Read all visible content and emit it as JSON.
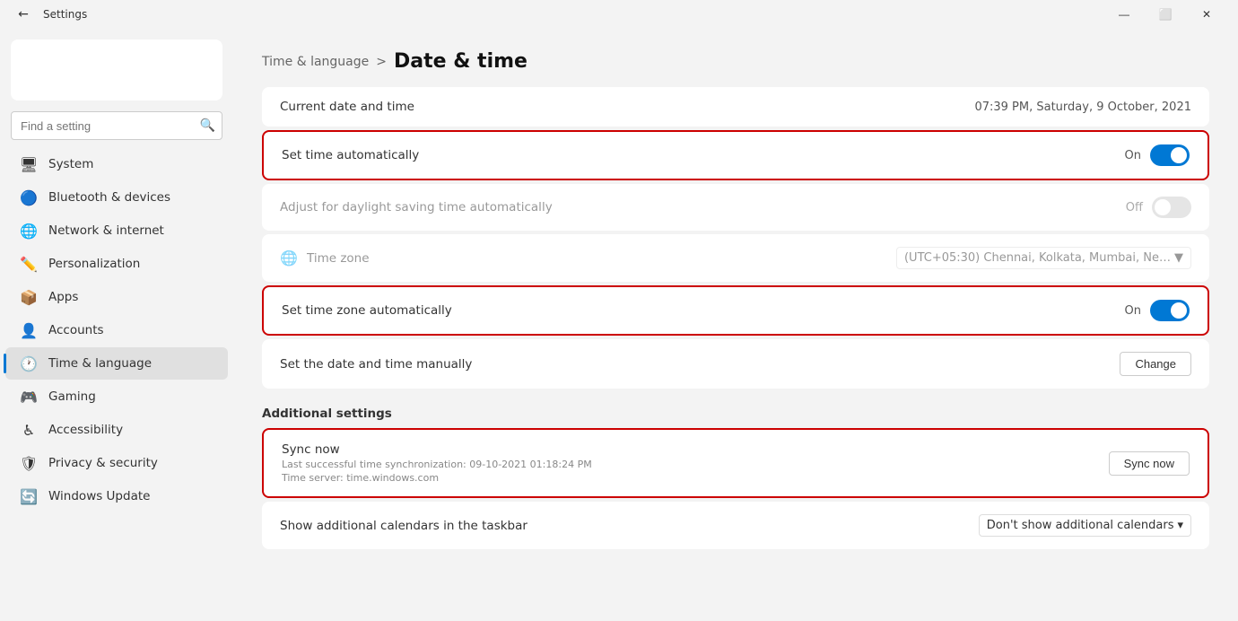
{
  "titlebar": {
    "title": "Settings",
    "minimize": "—",
    "maximize": "⬜",
    "close": "✕"
  },
  "sidebar": {
    "search_placeholder": "Find a setting",
    "items": [
      {
        "id": "system",
        "label": "System",
        "icon": "🖥",
        "active": false
      },
      {
        "id": "bluetooth",
        "label": "Bluetooth & devices",
        "icon": "🔵",
        "active": false
      },
      {
        "id": "network",
        "label": "Network & internet",
        "icon": "🌐",
        "active": false
      },
      {
        "id": "personalization",
        "label": "Personalization",
        "icon": "✏️",
        "active": false
      },
      {
        "id": "apps",
        "label": "Apps",
        "icon": "📦",
        "active": false
      },
      {
        "id": "accounts",
        "label": "Accounts",
        "icon": "👤",
        "active": false
      },
      {
        "id": "time-language",
        "label": "Time & language",
        "icon": "🕐",
        "active": true
      },
      {
        "id": "gaming",
        "label": "Gaming",
        "icon": "🎮",
        "active": false
      },
      {
        "id": "accessibility",
        "label": "Accessibility",
        "icon": "♿",
        "active": false
      },
      {
        "id": "privacy-security",
        "label": "Privacy & security",
        "icon": "🛡",
        "active": false
      },
      {
        "id": "windows-update",
        "label": "Windows Update",
        "icon": "🔄",
        "active": false
      }
    ]
  },
  "content": {
    "breadcrumb_parent": "Time & language",
    "breadcrumb_sep": ">",
    "page_title": "Date & time",
    "current_date_label": "Current date and time",
    "current_date_value": "07:39 PM, Saturday, 9 October, 2021",
    "set_time_auto_label": "Set time automatically",
    "set_time_auto_state": "On",
    "set_time_auto_on": true,
    "daylight_label": "Adjust for daylight saving time automatically",
    "daylight_state": "Off",
    "daylight_on": false,
    "timezone_label": "Time zone",
    "timezone_value": "(UTC+05:30) Chennai, Kolkata, Mumbai, Ne…",
    "set_timezone_auto_label": "Set time zone automatically",
    "set_timezone_auto_state": "On",
    "set_timezone_auto_on": true,
    "manual_date_label": "Set the date and time manually",
    "change_btn": "Change",
    "additional_settings_header": "Additional settings",
    "sync_title": "Sync now",
    "sync_last": "Last successful time synchronization: 09-10-2021 01:18:24 PM",
    "sync_server": "Time server: time.windows.com",
    "sync_btn": "Sync now",
    "calendar_label": "Show additional calendars in the taskbar",
    "calendar_value": "Don't show additional calendars",
    "calendar_chevron": "▾"
  }
}
